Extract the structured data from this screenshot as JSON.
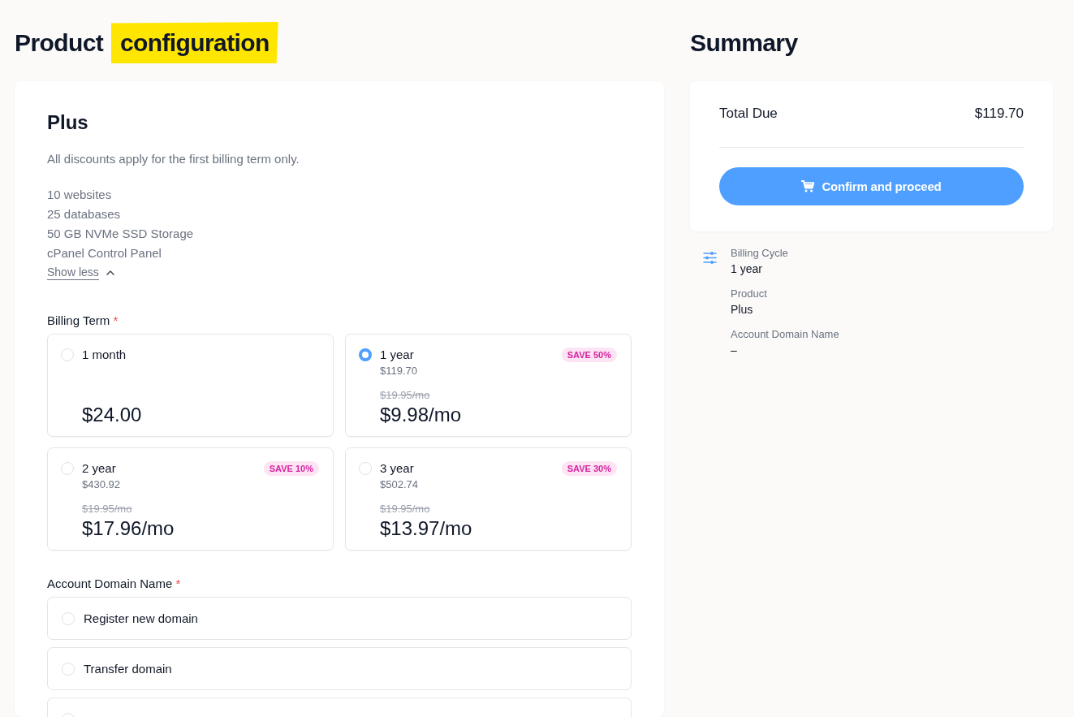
{
  "heading": {
    "text": "Product",
    "highlight": "configuration"
  },
  "product": {
    "name": "Plus",
    "note": "All discounts apply for the first billing term only.",
    "features": [
      "10 websites",
      "25 databases",
      "50 GB NVMe SSD Storage",
      "cPanel Control Panel"
    ],
    "toggle": {
      "label": "Show less",
      "expanded": true
    }
  },
  "billing_term": {
    "label": "Billing Term",
    "required_mark": "*",
    "options": [
      {
        "label": "1 month",
        "selected": false,
        "price": "$24.00"
      },
      {
        "label": "1 year",
        "selected": true,
        "badge": "SAVE 50%",
        "total": "$119.70",
        "original_price": "$19.95/mo",
        "price": "$9.98/mo"
      },
      {
        "label": "2 year",
        "selected": false,
        "badge": "SAVE 10%",
        "total": "$430.92",
        "original_price": "$19.95/mo",
        "price": "$17.96/mo"
      },
      {
        "label": "3 year",
        "selected": false,
        "badge": "SAVE 30%",
        "total": "$502.74",
        "original_price": "$19.95/mo",
        "price": "$13.97/mo"
      }
    ]
  },
  "account_domain": {
    "label": "Account Domain Name",
    "required_mark": "*",
    "options": [
      {
        "label": "Register new domain",
        "selected": false
      },
      {
        "label": "Transfer domain",
        "selected": false
      },
      {
        "selected": false
      }
    ]
  },
  "summary": {
    "title": "Summary",
    "total_label": "Total Due",
    "total": "$119.70",
    "button": "Confirm and proceed",
    "details": [
      {
        "label": "Billing Cycle",
        "value": "1 year"
      },
      {
        "label": "Product",
        "value": "Plus"
      },
      {
        "label": "Account Domain Name",
        "value": "–"
      }
    ]
  }
}
